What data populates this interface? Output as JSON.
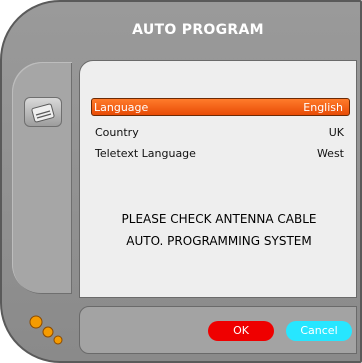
{
  "window": {
    "title": "AUTO PROGRAM"
  },
  "settings": [
    {
      "label": "Language",
      "value": "English",
      "selected": true
    },
    {
      "label": "Country",
      "value": "UK",
      "selected": false
    },
    {
      "label": "Teletext Language",
      "value": "West",
      "selected": false
    }
  ],
  "message": {
    "line1": "PLEASE CHECK ANTENNA CABLE",
    "line2": "AUTO. PROGRAMMING SYSTEM"
  },
  "buttons": {
    "ok_label": "OK",
    "cancel_label": "Cancel"
  },
  "colors": {
    "selected_row": "#f0600f",
    "ok_button": "#ef0000",
    "cancel_button": "#27e6ff",
    "frame": "#8f8f8f",
    "panel": "#eeeeee"
  },
  "icons": {
    "side_icon": "tools-icon",
    "corner_icon": "orange-dots-icon"
  }
}
